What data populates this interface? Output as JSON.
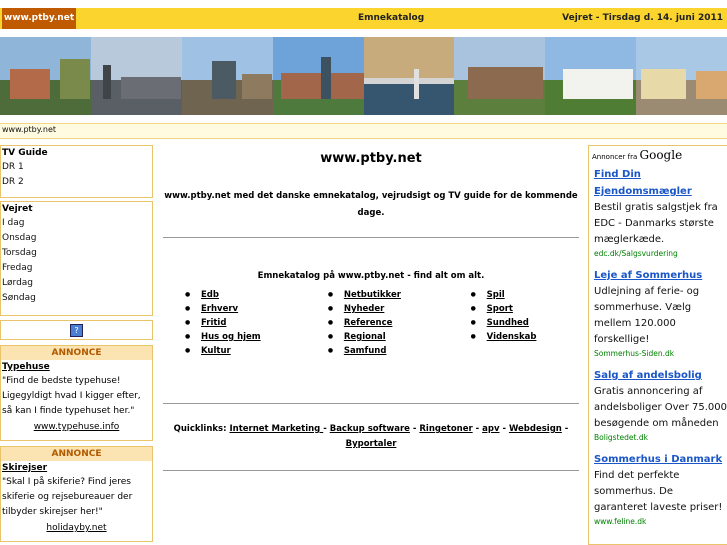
{
  "header": {
    "logo": "www.ptby.net",
    "nav_label": "Emnekatalog",
    "date_text": "Vejret - Tirsdag d. 14. juni 2011"
  },
  "breadcrumb": "www.ptby.net",
  "sidebar": {
    "tv": {
      "title": "TV Guide",
      "items": [
        "DR 1",
        "DR 2"
      ]
    },
    "weather": {
      "title": "Vejret",
      "items": [
        "I dag",
        "Onsdag",
        "Torsdag",
        "Fredag",
        "Lørdag",
        "Søndag"
      ]
    },
    "help_icon": "?",
    "ads": [
      {
        "header": "ANNONCE",
        "title": "Typehuse",
        "text": "\"Find de bedste typehuse! Ligegyldigt hvad I kigger efter, så kan I finde typehuset her.\"",
        "url": "www.typehuse.info"
      },
      {
        "header": "ANNONCE",
        "title": "Skirejser",
        "text": "\"Skal I på skiferie? Find jeres skiferie og rejsebureauer der tilbyder skirejser her!\"",
        "url": "holidayby.net"
      }
    ]
  },
  "main": {
    "title": "www.ptby.net",
    "intro": "www.ptby.net med det danske emnekatalog, vejrudsigt og TV guide for de kommende dage.",
    "catalog_title": "Emnekatalog på www.ptby.net - find alt om alt.",
    "columns": [
      [
        "Edb",
        "Erhverv",
        "Fritid",
        "Hus og hjem",
        "Kultur"
      ],
      [
        "Netbutikker",
        "Nyheder",
        "Reference",
        "Regional",
        "Samfund"
      ],
      [
        "Spil",
        "Sport",
        "Sundhed",
        "Videnskab"
      ]
    ],
    "quick_label": "Quicklinks:",
    "quicklinks": [
      "Internet Marketing ",
      "Backup software",
      "Ringetoner",
      "apv",
      "Webdesign",
      "Byportaler"
    ]
  },
  "right": {
    "ads_by": "Annoncer fra",
    "brand": "Google",
    "ads": [
      {
        "title": "Find Din Ejendomsmægler",
        "text": "Bestil gratis salgstjek fra EDC - Danmarks største mæglerkæde.",
        "url": "edc.dk/Salgsvurdering"
      },
      {
        "title": "Leje af Sommerhus",
        "text": "Udlejning af ferie- og sommerhuse. Vælg mellem 120.000 forskellige!",
        "url": "Sommerhus-Siden.dk"
      },
      {
        "title": "Salg af andelsbolig",
        "text": "Gratis annoncering af andelsboliger Over 75.000 besøgende om måneden",
        "url": "Boligstedet.dk"
      },
      {
        "title": "Sommerhus i Danmark",
        "text": "Find det perfekte sommerhus. De garanteret laveste priser!",
        "url": "www.feline.dk"
      }
    ]
  },
  "colors": {
    "topbar": "#fbd52e",
    "logo_bg": "#c05a00",
    "ad_title": "#1a56c8",
    "ad_url": "#008000"
  }
}
